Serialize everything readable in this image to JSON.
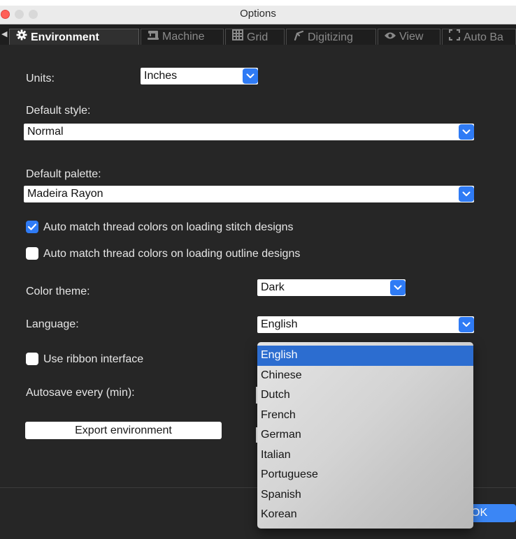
{
  "window": {
    "title": "Options"
  },
  "tabs": [
    {
      "label": "Environment",
      "icon": "gear-icon",
      "active": true
    },
    {
      "label": "Machine",
      "icon": "sewing-machine-icon",
      "active": false
    },
    {
      "label": "Grid",
      "icon": "grid-icon",
      "active": false
    },
    {
      "label": "Digitizing",
      "icon": "digitizing-icon",
      "active": false
    },
    {
      "label": "View",
      "icon": "eye-icon",
      "active": false
    },
    {
      "label": "Auto Ba",
      "icon": "auto-bracket-icon",
      "active": false
    }
  ],
  "environment": {
    "units_label": "Units:",
    "units_value": "Inches",
    "default_style_label": "Default style:",
    "default_style_value": "Normal",
    "default_palette_label": "Default palette:",
    "default_palette_value": "Madeira Rayon",
    "auto_match_stitch_label": "Auto match thread colors on loading stitch designs",
    "auto_match_stitch_checked": true,
    "auto_match_outline_label": "Auto match thread colors on loading outline designs",
    "auto_match_outline_checked": false,
    "color_theme_label": "Color theme:",
    "color_theme_value": "Dark",
    "language_label": "Language:",
    "language_value": "English",
    "ribbon_label": "Use ribbon interface",
    "ribbon_checked": false,
    "autosave_label": "Autosave every (min):",
    "export_button_label": "Export environment"
  },
  "language_dropdown": {
    "selected": "English",
    "options": [
      "English",
      "Chinese",
      "Dutch",
      "French",
      "German",
      "Italian",
      "Portuguese",
      "Spanish",
      "Korean"
    ]
  },
  "footer": {
    "ok_label": "OK",
    "ok_visible_text": "OK"
  },
  "colors": {
    "accent": "#2f7bf5",
    "selection": "#2c6dd0",
    "background": "#262626",
    "close_button": "#ff5f57"
  }
}
